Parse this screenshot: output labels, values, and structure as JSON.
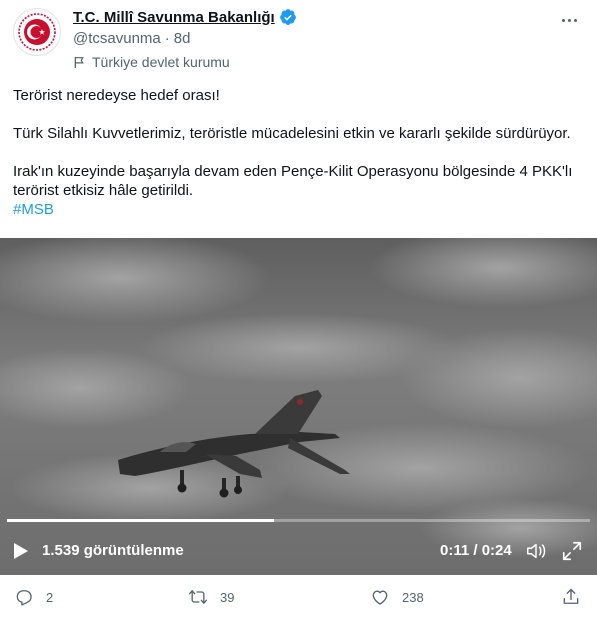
{
  "account": {
    "display_name": "T.C. Millî Savunma Bakanlığı",
    "handle": "@tcsavunma",
    "separator": "·",
    "time_ago": "8d",
    "label": "Türkiye devlet kurumu"
  },
  "tweet": {
    "line1": "Terörist neredeyse hedef orası!",
    "line2": "Türk Silahlı Kuvvetlerimiz, teröristle mücadelesini etkin ve kararlı şekilde sürdürüyor.",
    "line3a": "Irak'ın kuzeyinde başarıyla devam eden Pençe-Kilit Operasyonu bölgesinde 4 PKK'lı",
    "line3b": "terörist etkisiz hâle getirildi.",
    "hashtag": "#MSB"
  },
  "video": {
    "views": "1.539 görüntülenme",
    "time": "0:11 / 0:24",
    "progress": 0.4583
  },
  "actions": {
    "replies": "2",
    "retweets": "39",
    "likes": "238"
  },
  "icons": {
    "avatar": "msb-emblem-icon",
    "verified": "verified-badge-icon",
    "label": "flag-icon",
    "more": "more-icon",
    "play": "play-icon",
    "volume": "volume-icon",
    "fullscreen": "fullscreen-icon",
    "reply": "reply-icon",
    "retweet": "retweet-icon",
    "like": "like-icon",
    "share": "share-icon"
  },
  "colors": {
    "emblem_red": "#c8102e",
    "verified_blue": "#1d9bf0",
    "hashtag_blue": "#1d9bf0",
    "secondary_text": "#536471"
  }
}
